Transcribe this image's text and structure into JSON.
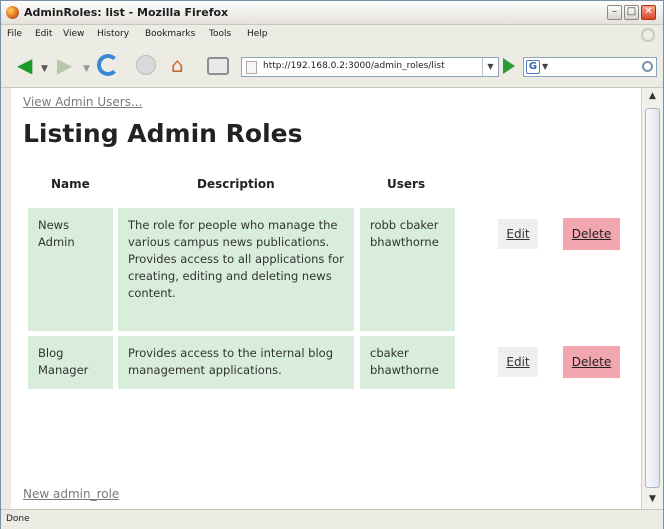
{
  "window": {
    "title": "AdminRoles: list - Mozilla Firefox"
  },
  "menu": [
    "File",
    "Edit",
    "View",
    "History",
    "Bookmarks",
    "Tools",
    "Help"
  ],
  "nav": {
    "url": "http://192.168.0.2:3000/admin_roles/list",
    "search_placeholder": ""
  },
  "page": {
    "top_link": "View Admin Users...",
    "heading": "Listing Admin Roles",
    "columns": [
      "Name",
      "Description",
      "Users"
    ],
    "rows": [
      {
        "name": "News Admin",
        "description": "The role for people who manage the various campus news publications. Provides access to all applications for creating, editing and deleting news content.",
        "users": "robb cbaker bhawthorne",
        "edit": "Edit",
        "delete": "Delete"
      },
      {
        "name": "Blog Manager",
        "description": "Provides access to the internal blog management applications.",
        "users": "cbaker bhawthorne",
        "edit": "Edit",
        "delete": "Delete"
      }
    ],
    "bottom_link": "New admin_role"
  },
  "status": {
    "text": "Done"
  },
  "colors": {
    "row_bg": "#d8eedb",
    "delete_bg": "#f1a6b0",
    "edit_bg": "#efefef"
  }
}
